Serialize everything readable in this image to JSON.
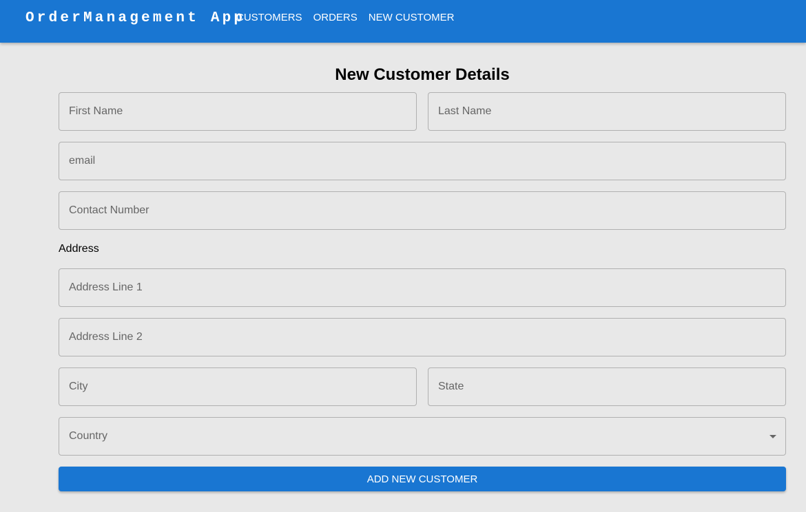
{
  "appbar": {
    "brand": "OrderManagement App",
    "nav": [
      "CUSTOMERS",
      "ORDERS",
      "NEW CUSTOMER"
    ],
    "color": "#1976d2"
  },
  "form": {
    "title": "New Customer Details",
    "first_name": {
      "placeholder": "First Name",
      "value": ""
    },
    "last_name": {
      "placeholder": "Last Name",
      "value": ""
    },
    "email": {
      "placeholder": "email",
      "value": ""
    },
    "contact_number": {
      "placeholder": "Contact Number",
      "value": ""
    },
    "address_label": "Address",
    "address_line1": {
      "placeholder": "Address Line 1",
      "value": ""
    },
    "address_line2": {
      "placeholder": "Address Line 2",
      "value": ""
    },
    "city": {
      "placeholder": "City",
      "value": ""
    },
    "state": {
      "placeholder": "State",
      "value": ""
    },
    "country": {
      "label": "Country",
      "icon": "chevron-down-icon"
    },
    "submit_label": "ADD NEW CUSTOMER"
  }
}
